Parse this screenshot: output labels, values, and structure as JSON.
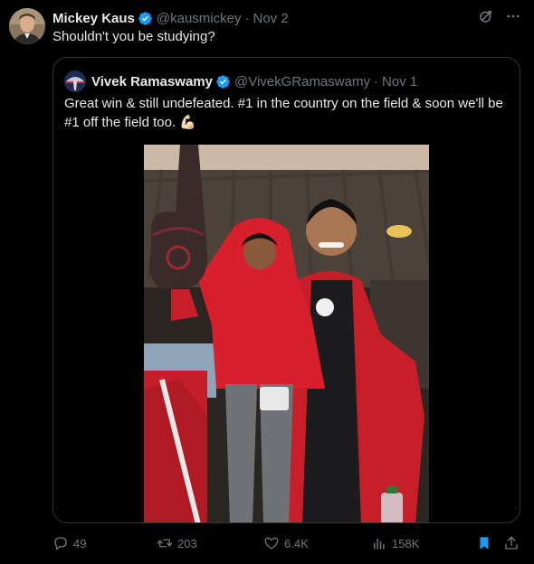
{
  "author": {
    "name": "Mickey Kaus",
    "handle": "@kausmickey",
    "separator": "·",
    "date": "Nov 2"
  },
  "tweet_text": "Shouldn't you be studying?",
  "quoted": {
    "name": "Vivek Ramaswamy",
    "handle": "@VivekGRamaswamy",
    "separator": "·",
    "date": "Nov 1",
    "text": "Great win & still undefeated. #1 in the country on the field & soon we'll be #1 off the field too. 💪🏻",
    "image_alt": "Man in red jacket holding a child in a red jacket, child holding a foam finger, at a stadium"
  },
  "actions": {
    "replies": "49",
    "reposts": "203",
    "likes": "6.4K",
    "views": "158K"
  },
  "icons": {
    "verified": "verified-badge-icon",
    "grok": "grok-icon",
    "more": "more-icon",
    "reply": "reply-icon",
    "repost": "repost-icon",
    "like": "like-icon",
    "views": "views-icon",
    "bookmark": "bookmark-icon",
    "share": "share-icon"
  },
  "colors": {
    "background": "#000000",
    "text": "#e7e9ea",
    "muted": "#71767b",
    "accent": "#1d9bf0",
    "border": "#2f3336"
  }
}
